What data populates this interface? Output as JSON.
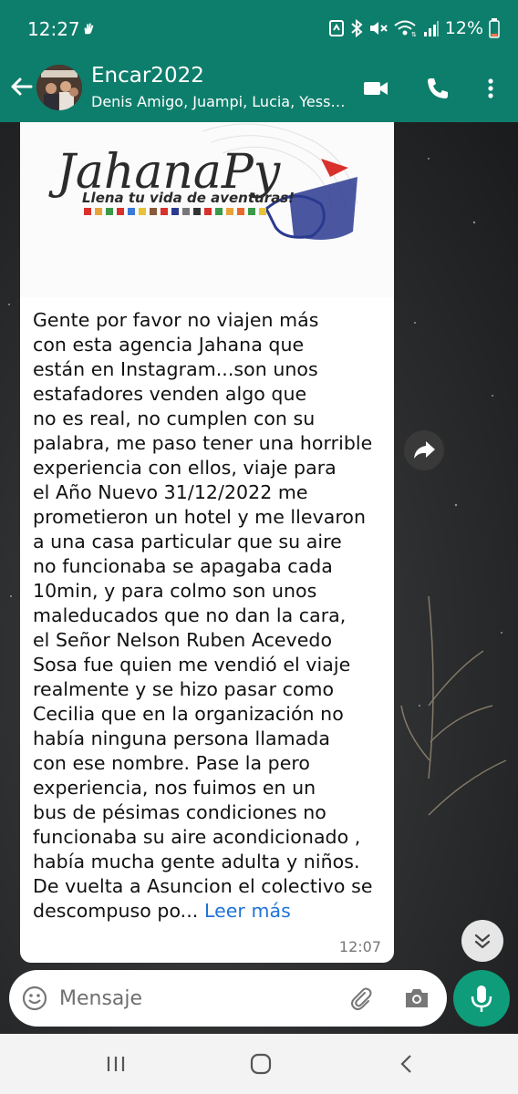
{
  "status_bar": {
    "time": "12:27",
    "battery": "12%",
    "icons": [
      "hand-icon",
      "nfc-icon",
      "bluetooth-icon",
      "mute-icon",
      "wifi-icon",
      "signal-icon",
      "battery-icon"
    ]
  },
  "header": {
    "title": "Encar2022",
    "subtitle": "Denis Amigo, Juampi, Lucia, Yessica",
    "icons": [
      "back-arrow-icon",
      "video-call-icon",
      "phone-icon",
      "more-vert-icon"
    ]
  },
  "message": {
    "image": {
      "brand_text": "JahanaPy",
      "tagline": "Llena tu vida de aventuras!"
    },
    "text": "Gente por favor no viajen más\ncon esta agencia Jahana que\nestán en Instagram...son unos\nestafadores venden algo que\nno es real, no cumplen con su\npalabra, me paso tener una horrible\nexperiencia con ellos, viaje para\nel Año Nuevo 31/12/2022 me\nprometieron un hotel y me llevaron\na una casa particular que su aire\nno funcionaba se apagaba cada\n10min, y para colmo son unos\nmaleducados que no dan la cara,\nel Señor Nelson Ruben Acevedo\nSosa fue quien me vendió el viaje\nrealmente y se hizo pasar como\nCecilia que en la organización no\nhabía ninguna persona llamada\ncon ese nombre. Pase la pero\nexperiencia, nos fuimos en un\nbus de pésimas condiciones no\nfuncionaba su aire acondicionado ,\nhabía mucha gente adulta y niños.\nDe vuelta a Asuncion el colectivo se\ndescompuso po...",
    "read_more": "Leer más",
    "time": "12:07"
  },
  "composer": {
    "placeholder": "Mensaje",
    "value": ""
  },
  "colors": {
    "brand": "#0e7e6c",
    "mic": "#0e9c7a",
    "link": "#1e73d8"
  }
}
